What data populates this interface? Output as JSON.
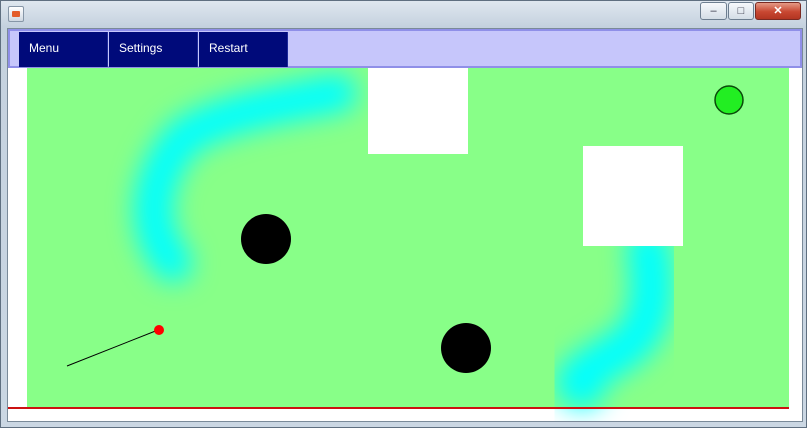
{
  "window": {
    "title": "",
    "minimize_glyph": "–",
    "maximize_glyph": "□",
    "close_glyph": "✕"
  },
  "menu": {
    "items": [
      {
        "label": "Menu"
      },
      {
        "label": "Settings"
      },
      {
        "label": "Restart"
      }
    ]
  },
  "game": {
    "colors": {
      "grass": "#88ff88",
      "water": "#00ffff",
      "wall": "#ffffff",
      "hole": "#000000",
      "ball": "#ff0000",
      "target": "#22ee22",
      "boundary": "#cc1111"
    },
    "icons": {
      "hole": "hole-icon",
      "ball": "ball-icon",
      "target": "target-icon"
    }
  }
}
